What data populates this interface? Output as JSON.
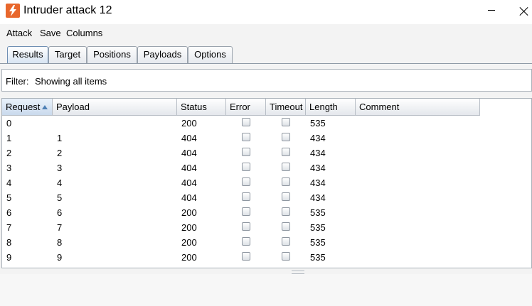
{
  "window": {
    "title": "Intruder attack 12"
  },
  "menu": {
    "attack": "Attack",
    "save": "Save",
    "columns": "Columns"
  },
  "tabs": [
    {
      "label": "Results",
      "active": true
    },
    {
      "label": "Target"
    },
    {
      "label": "Positions"
    },
    {
      "label": "Payloads"
    },
    {
      "label": "Options"
    }
  ],
  "filter": {
    "label": "Filter:",
    "value": "Showing all items"
  },
  "table": {
    "columns": [
      "Request",
      "Payload",
      "Status",
      "Error",
      "Timeout",
      "Length",
      "Comment"
    ],
    "sorted_column": "Request",
    "rows": [
      {
        "request": "0",
        "payload": "",
        "status": "200",
        "error": false,
        "timeout": false,
        "length": "535",
        "comment": ""
      },
      {
        "request": "1",
        "payload": "1",
        "status": "404",
        "error": false,
        "timeout": false,
        "length": "434",
        "comment": ""
      },
      {
        "request": "2",
        "payload": "2",
        "status": "404",
        "error": false,
        "timeout": false,
        "length": "434",
        "comment": ""
      },
      {
        "request": "3",
        "payload": "3",
        "status": "404",
        "error": false,
        "timeout": false,
        "length": "434",
        "comment": ""
      },
      {
        "request": "4",
        "payload": "4",
        "status": "404",
        "error": false,
        "timeout": false,
        "length": "434",
        "comment": ""
      },
      {
        "request": "5",
        "payload": "5",
        "status": "404",
        "error": false,
        "timeout": false,
        "length": "434",
        "comment": ""
      },
      {
        "request": "6",
        "payload": "6",
        "status": "200",
        "error": false,
        "timeout": false,
        "length": "535",
        "comment": ""
      },
      {
        "request": "7",
        "payload": "7",
        "status": "200",
        "error": false,
        "timeout": false,
        "length": "535",
        "comment": ""
      },
      {
        "request": "8",
        "payload": "8",
        "status": "200",
        "error": false,
        "timeout": false,
        "length": "535",
        "comment": ""
      },
      {
        "request": "9",
        "payload": "9",
        "status": "200",
        "error": false,
        "timeout": false,
        "length": "535",
        "comment": ""
      }
    ]
  },
  "icons": {
    "app": "burp-lightning-icon"
  },
  "colors": {
    "accent": "#e8672c",
    "sort_arrow": "#4d7fb5"
  }
}
